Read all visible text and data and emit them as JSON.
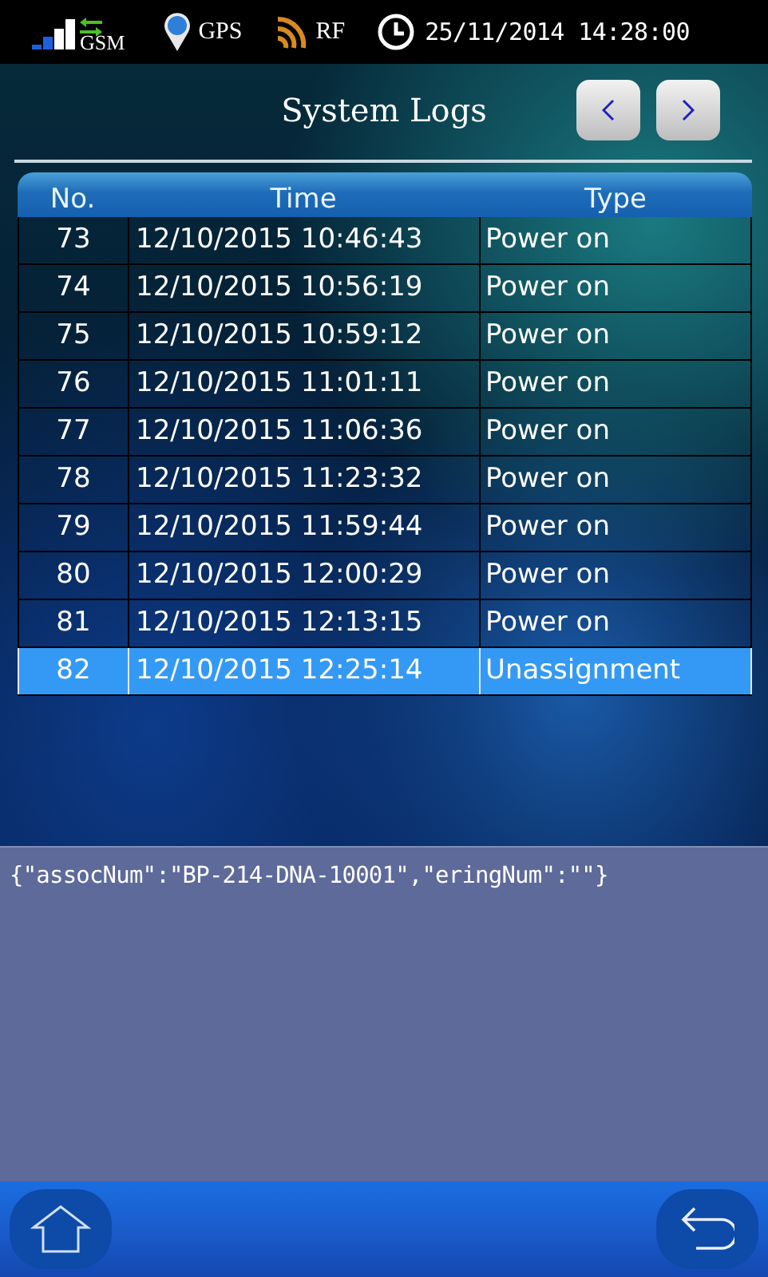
{
  "status_bar": {
    "gsm_label": "GSM",
    "gps_label": "GPS",
    "rf_label": "RF",
    "datetime": "25/11/2014 14:28:00"
  },
  "title": "System Logs",
  "table": {
    "columns": [
      "No.",
      "Time",
      "Type"
    ],
    "rows": [
      {
        "cells": [
          "73",
          "12/10/2015 10:46:43",
          "Power on"
        ],
        "selected": false
      },
      {
        "cells": [
          "74",
          "12/10/2015 10:56:19",
          "Power on"
        ],
        "selected": false
      },
      {
        "cells": [
          "75",
          "12/10/2015 10:59:12",
          "Power on"
        ],
        "selected": false
      },
      {
        "cells": [
          "76",
          "12/10/2015 11:01:11",
          "Power on"
        ],
        "selected": false
      },
      {
        "cells": [
          "77",
          "12/10/2015 11:06:36",
          "Power on"
        ],
        "selected": false
      },
      {
        "cells": [
          "78",
          "12/10/2015 11:23:32",
          "Power on"
        ],
        "selected": false
      },
      {
        "cells": [
          "79",
          "12/10/2015 11:59:44",
          "Power on"
        ],
        "selected": false
      },
      {
        "cells": [
          "80",
          "12/10/2015 12:00:29",
          "Power on"
        ],
        "selected": false
      },
      {
        "cells": [
          "81",
          "12/10/2015 12:13:15",
          "Power on"
        ],
        "selected": false
      },
      {
        "cells": [
          "82",
          "12/10/2015 12:25:14",
          "Unassignment"
        ],
        "selected": true
      }
    ]
  },
  "detail_text": "{\"assocNum\":\"BP-214-DNA-10001\",\"eringNum\":\"\"}"
}
